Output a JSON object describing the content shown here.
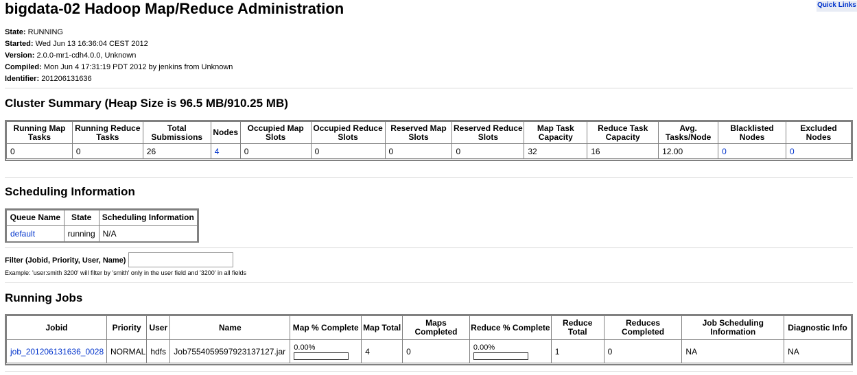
{
  "header": {
    "title": "bigdata-02 Hadoop Map/Reduce Administration",
    "quick_links": "Quick Links"
  },
  "info": {
    "state_label": "State:",
    "state": "RUNNING",
    "started_label": "Started:",
    "started": "Wed Jun 13 16:36:04 CEST 2012",
    "version_label": "Version:",
    "version": "2.0.0-mr1-cdh4.0.0, Unknown",
    "compiled_label": "Compiled:",
    "compiled": "Mon Jun 4 17:31:19 PDT 2012 by jenkins from Unknown",
    "identifier_label": "Identifier:",
    "identifier": "201206131636"
  },
  "cluster_summary": {
    "title": "Cluster Summary (Heap Size is 96.5 MB/910.25 MB)",
    "headers": [
      "Running Map Tasks",
      "Running Reduce Tasks",
      "Total Submissions",
      "Nodes",
      "Occupied Map Slots",
      "Occupied Reduce Slots",
      "Reserved Map Slots",
      "Reserved Reduce Slots",
      "Map Task Capacity",
      "Reduce Task Capacity",
      "Avg. Tasks/Node",
      "Blacklisted Nodes",
      "Excluded Nodes"
    ],
    "values": [
      "0",
      "0",
      "26",
      "4",
      "0",
      "0",
      "0",
      "0",
      "32",
      "16",
      "12.00",
      "0",
      "0"
    ]
  },
  "scheduling": {
    "title": "Scheduling Information",
    "headers": [
      "Queue Name",
      "State",
      "Scheduling Information"
    ],
    "row": {
      "queue": "default",
      "state": "running",
      "info": "N/A"
    }
  },
  "filter": {
    "label": "Filter (Jobid, Priority, User, Name)",
    "value": "",
    "example": "Example: 'user:smith 3200' will filter by 'smith' only in the user field and '3200' in all fields"
  },
  "running_jobs": {
    "title": "Running Jobs",
    "headers": [
      "Jobid",
      "Priority",
      "User",
      "Name",
      "Map % Complete",
      "Map Total",
      "Maps Completed",
      "Reduce % Complete",
      "Reduce Total",
      "Reduces Completed",
      "Job Scheduling Information",
      "Diagnostic Info"
    ],
    "jobs": [
      {
        "jobid": "job_201206131636_0028",
        "priority": "NORMAL",
        "user": "hdfs",
        "name": "Job7554059597923137127.jar",
        "map_pct": "0.00%",
        "map_progress": 0,
        "map_total": "4",
        "maps_completed": "0",
        "reduce_pct": "0.00%",
        "reduce_progress": 0,
        "reduce_total": "1",
        "reduces_completed": "0",
        "sched_info": "NA",
        "diag_info": "NA"
      }
    ]
  }
}
